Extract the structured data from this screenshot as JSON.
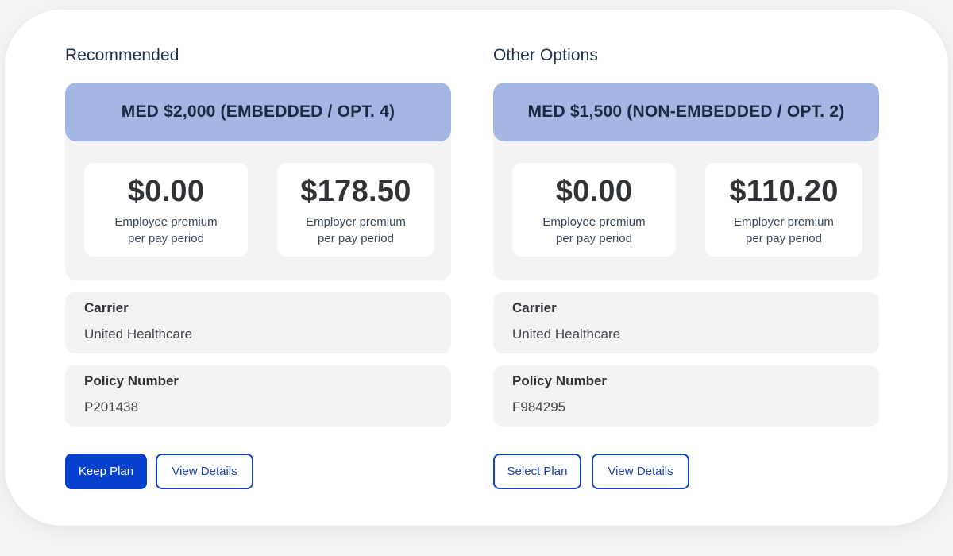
{
  "sections": [
    {
      "title": "Recommended",
      "plan": {
        "name": "MED $2,000 (EMBEDDED / OPT. 4)",
        "employee_premium": {
          "amount": "$0.00",
          "label_line1": "Employee premium",
          "label_line2": "per pay period"
        },
        "employer_premium": {
          "amount": "$178.50",
          "label_line1": "Employer premium",
          "label_line2": "per pay period"
        },
        "carrier": {
          "label": "Carrier",
          "value": "United Healthcare"
        },
        "policy": {
          "label": "Policy Number",
          "value": "P201438"
        }
      },
      "actions": {
        "primary_label": "Keep Plan",
        "secondary_label": "View Details"
      }
    },
    {
      "title": "Other Options",
      "plan": {
        "name": "MED $1,500 (NON-EMBEDDED / OPT. 2)",
        "employee_premium": {
          "amount": "$0.00",
          "label_line1": "Employee premium",
          "label_line2": "per pay period"
        },
        "employer_premium": {
          "amount": "$110.20",
          "label_line1": "Employer premium",
          "label_line2": "per pay period"
        },
        "carrier": {
          "label": "Carrier",
          "value": "United Healthcare"
        },
        "policy": {
          "label": "Policy Number",
          "value": "F984295"
        }
      },
      "actions": {
        "primary_label": "Select Plan",
        "secondary_label": "View Details"
      }
    }
  ],
  "colors": {
    "header_bg": "#a4b7e4",
    "primary_button": "#0640cc",
    "outline_button_border": "#1142c4",
    "panel_bg": "#f3f3f3"
  }
}
